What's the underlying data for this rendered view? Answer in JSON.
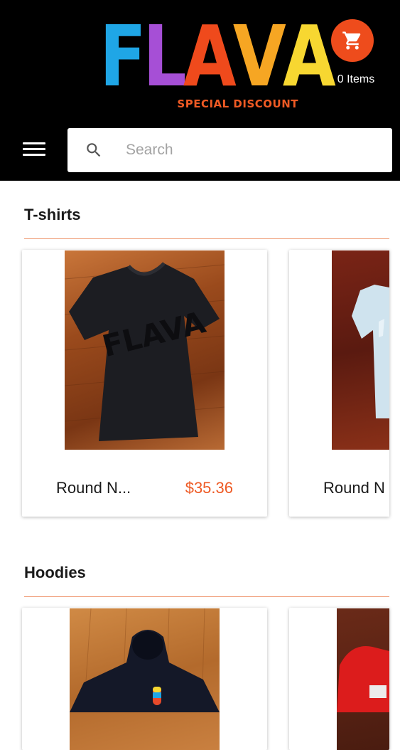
{
  "header": {
    "logo_letters": [
      {
        "char": "F",
        "color": "#1fa6e6"
      },
      {
        "char": "L",
        "color": "#a64fd6"
      },
      {
        "char": "A",
        "color": "#ef4a1c"
      },
      {
        "char": "V",
        "color": "#f6a623"
      },
      {
        "char": "A",
        "color": "#f7d731"
      }
    ],
    "logo_tagline": "SPECIAL DISCOUNT",
    "cart_icon": "shopping-cart-icon",
    "cart_count_label": "0 Items",
    "menu_icon": "hamburger-menu-icon",
    "search": {
      "placeholder": "Search",
      "value": "",
      "icon": "search-icon"
    }
  },
  "sections": [
    {
      "title": "T-shirts",
      "products": [
        {
          "name": "Round N...",
          "price": "$35.36",
          "image": "black-tshirt-flava-print"
        },
        {
          "name": "Round N",
          "price": "",
          "image": "light-blue-tshirt"
        }
      ]
    },
    {
      "title": "Hoodies",
      "products": [
        {
          "name": "",
          "price": "",
          "image": "navy-zip-hoodie"
        },
        {
          "name": "",
          "price": "",
          "image": "red-hoodie"
        }
      ]
    }
  ],
  "colors": {
    "accent": "#ee4c1c",
    "price": "#ee5a24",
    "header_bg": "#000000"
  }
}
